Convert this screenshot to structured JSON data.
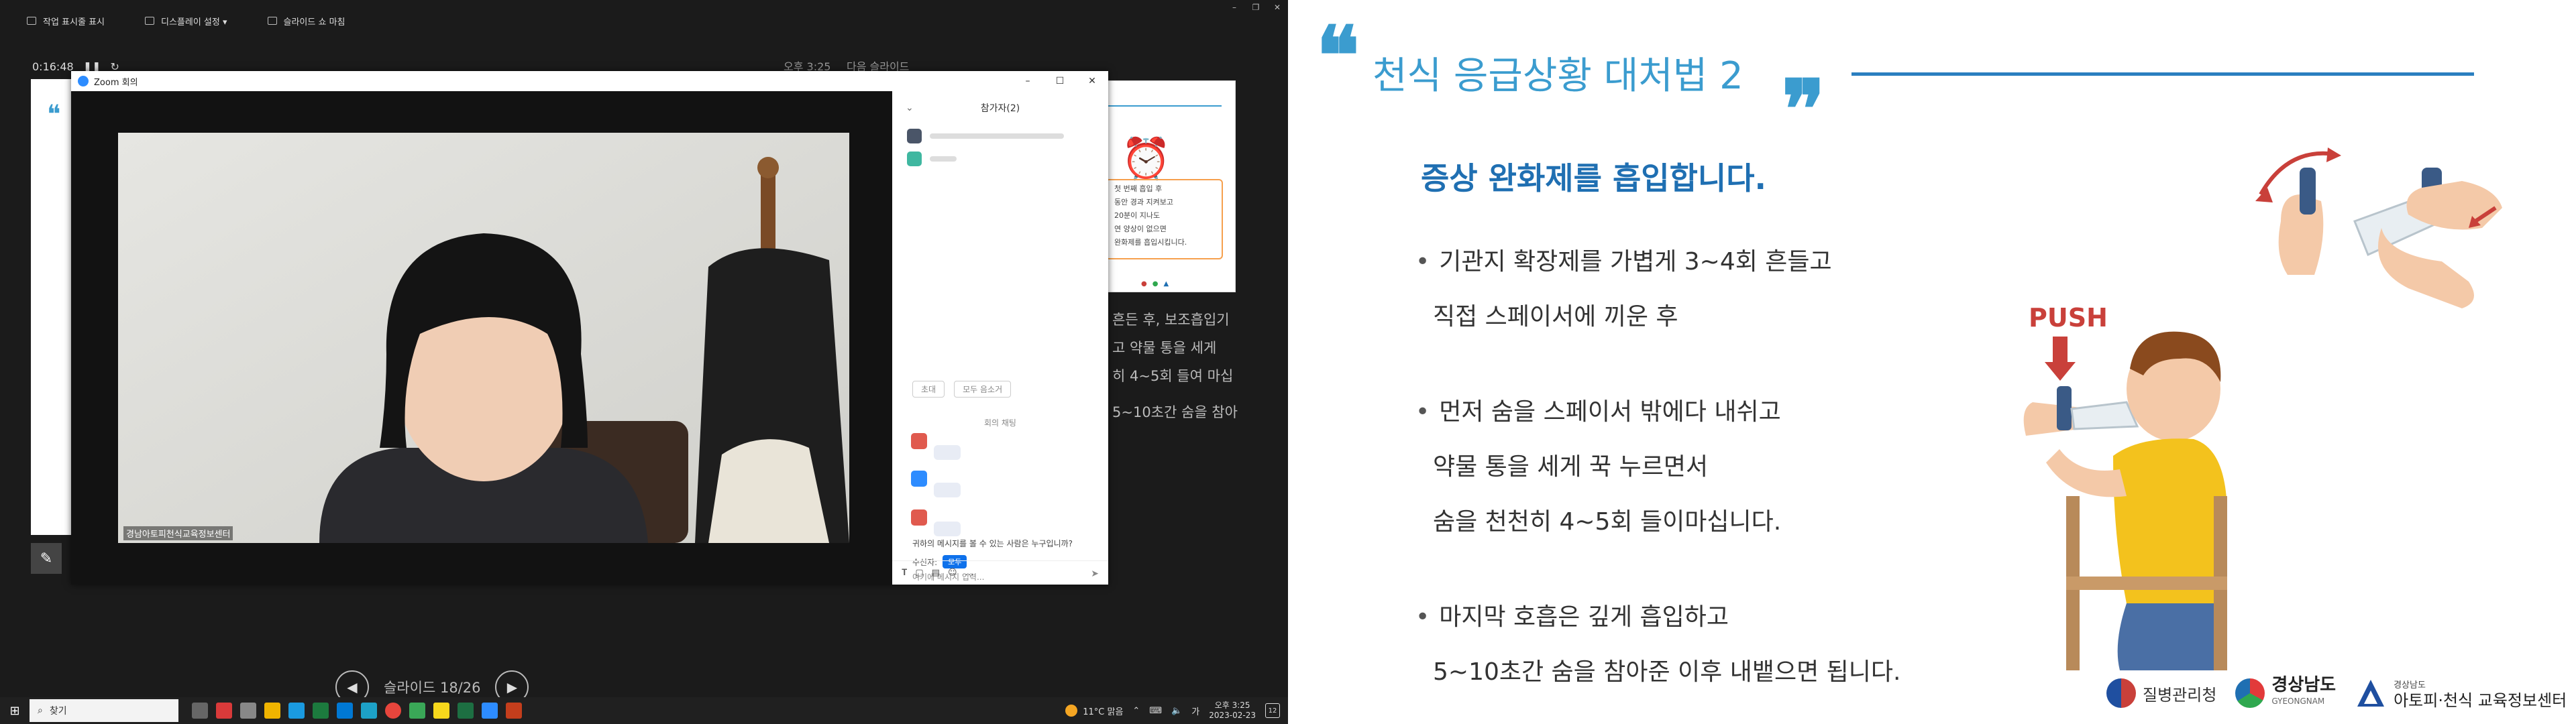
{
  "presenter": {
    "toolbar": {
      "taskbar_label": "작업 표시줄 표시",
      "display_label": "디스플레이 설정 ▾",
      "end_show_label": "슬라이드 쇼 마침"
    },
    "timer": "0:16:48",
    "clock": "오후 3:25",
    "next_slide_label": "다음 슬라이드",
    "next_thumbnail_text": [
      "첫 번째 흡입 후",
      "동안 경과 지켜보고",
      "20분이 지나도",
      "연 양상이 없으면",
      "완화제를 흡입시킵니다."
    ],
    "notes": [
      "흔든 후, 보조흡입기",
      "고 약물 통을 세게",
      "히 4~5회 들여 마십",
      "5~10초간 숨을 참아"
    ],
    "slide_counter": "슬라이드 18/26"
  },
  "zoom": {
    "title": "Zoom 회의",
    "participants_title": "참가자(2)",
    "participant_label": "경남아토피천식교육정보센터",
    "btn_invite": "초대",
    "btn_mute_all": "모두 음소거",
    "chat_title": "회의 채팅",
    "who_can_see": "귀하의 메시지를 볼 수 있는 사람은 누구입니까?",
    "recipient_label": "수신자:",
    "recipient_value": "모두",
    "input_placeholder": "여기에 메시지 입력..."
  },
  "taskbar": {
    "search_label": "찾기",
    "weather": "11°C 맑음",
    "time": "오후 3:25",
    "date": "2023-02-23",
    "lang": "가",
    "notif_count": "12"
  },
  "slide": {
    "title": "천식 응급상황 대처법 2",
    "subtitle": "증상 완화제를 흡입합니다.",
    "bullets": [
      [
        "기관지 확장제를 가볍게 3~4회 흔들고",
        "직접 스페이서에 끼운 후"
      ],
      [
        "먼저 숨을 스페이서 밖에다 내쉬고",
        "약물 통을 세게 꾹 누르면서",
        "숨을 천천히 4~5회 들이마십니다."
      ],
      [
        "마지막 호흡은 깊게 흡입하고",
        "5~10초간 숨을 참아준 이후 내뱉으면 됩니다."
      ]
    ],
    "push_label": "PUSH",
    "logo_kdca": "질병관리청",
    "logo_gn_kr": "경상남도",
    "logo_gn_en": "GYEONGNAM",
    "logo_atopy_small": "경상남도",
    "logo_atopy_big": "아토피·천식 교육정보센터"
  },
  "colors": {
    "title_blue": "#3b9ccf",
    "subtitle_blue": "#1f6fb2",
    "push_red": "#c9403a",
    "zoom_blue": "#2d8cff"
  }
}
